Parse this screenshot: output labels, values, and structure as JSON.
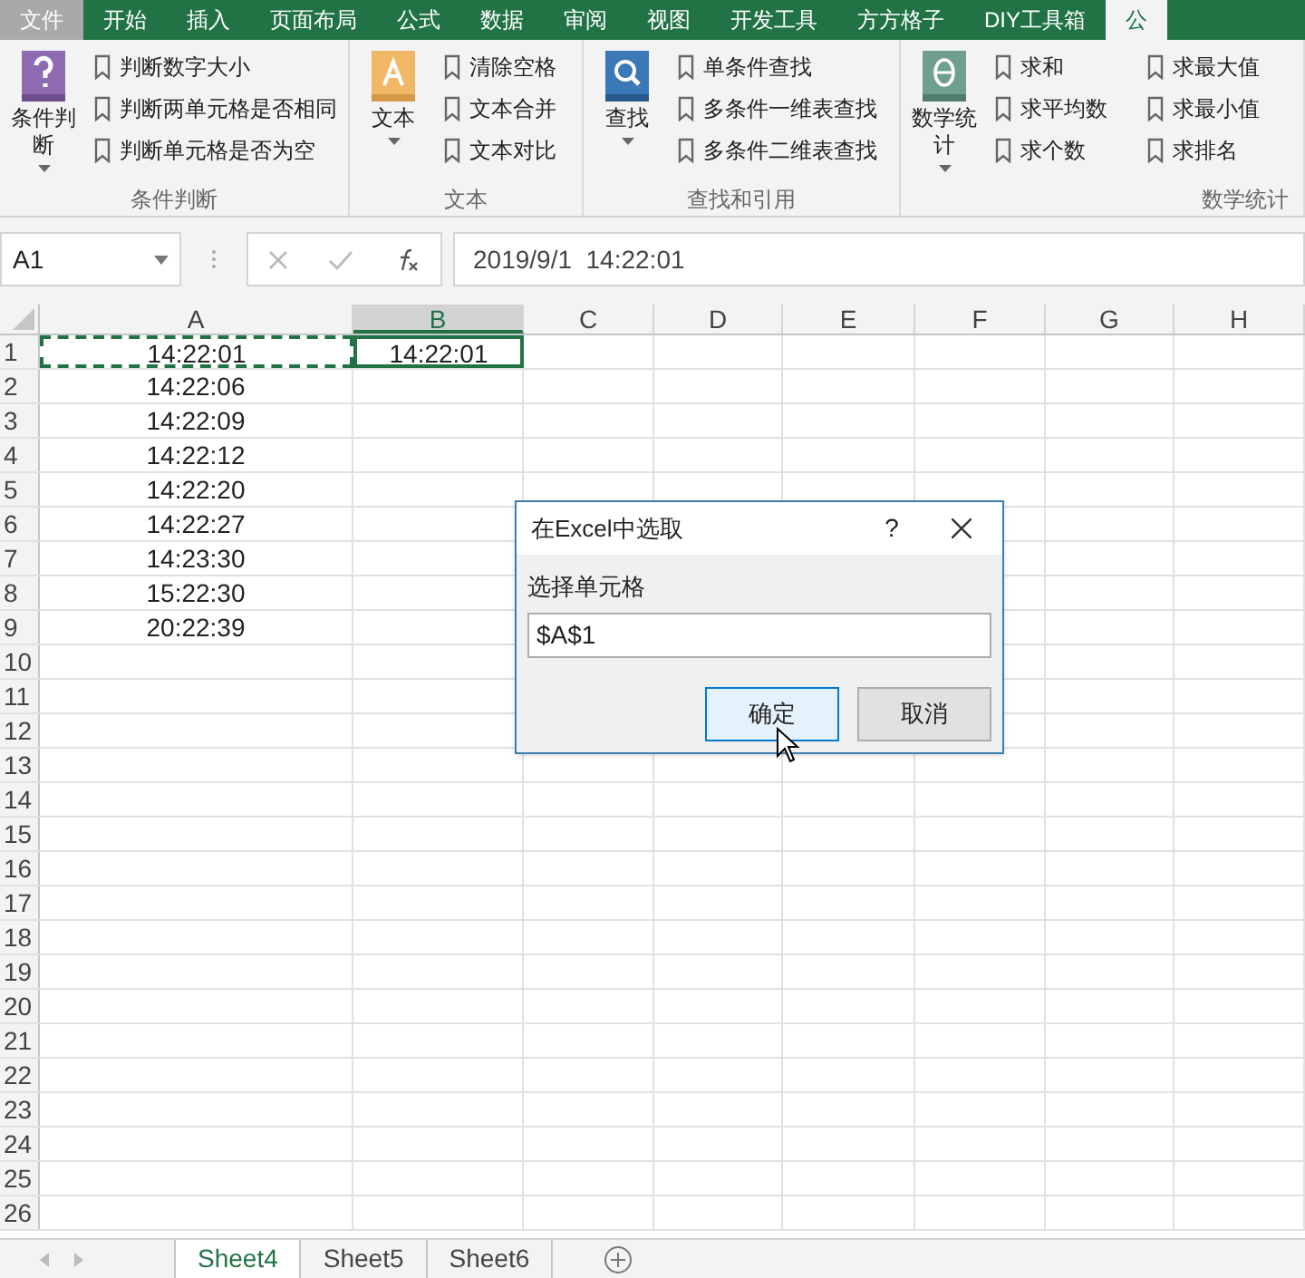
{
  "ribbon_tabs": [
    {
      "label": "文件",
      "kind": "file",
      "selected": false
    },
    {
      "label": "开始",
      "kind": "tab",
      "selected": false
    },
    {
      "label": "插入",
      "kind": "tab",
      "selected": false
    },
    {
      "label": "页面布局",
      "kind": "tab",
      "selected": false
    },
    {
      "label": "公式",
      "kind": "tab",
      "selected": false
    },
    {
      "label": "数据",
      "kind": "tab",
      "selected": false
    },
    {
      "label": "审阅",
      "kind": "tab",
      "selected": false
    },
    {
      "label": "视图",
      "kind": "tab",
      "selected": false
    },
    {
      "label": "开发工具",
      "kind": "tab",
      "selected": false
    },
    {
      "label": "方方格子",
      "kind": "tab",
      "selected": false
    },
    {
      "label": "DIY工具箱",
      "kind": "tab",
      "selected": false
    },
    {
      "label": "公",
      "kind": "tab",
      "selected": true
    }
  ],
  "ribbon_groups": [
    {
      "title": "条件判断",
      "big_button": {
        "label": "条件判断",
        "kind": "question"
      },
      "items": [
        "判断数字大小",
        "判断两单元格是否相同",
        "判断单元格是否为空"
      ]
    },
    {
      "title": "文本",
      "big_button": {
        "label": "文本",
        "kind": "text"
      },
      "items": [
        "清除空格",
        "文本合并",
        "文本对比"
      ]
    },
    {
      "title": "查找和引用",
      "big_button": {
        "label": "查找",
        "kind": "search"
      },
      "items": [
        "单条件查找",
        "多条件一维表查找",
        "多条件二维表查找"
      ]
    },
    {
      "title": "数学统计",
      "big_button": {
        "label": "数学统计",
        "kind": "theta"
      },
      "items": [
        "求和",
        "求平均数",
        "求个数"
      ],
      "items_2": [
        "求最大值",
        "求最小值",
        "求排名"
      ]
    }
  ],
  "formula_bar": {
    "name_box": "A1",
    "formula": "2019/9/1  14:22:01"
  },
  "columns": [
    {
      "label": "A",
      "selected": false
    },
    {
      "label": "B",
      "selected": true
    },
    {
      "label": "C",
      "selected": false
    },
    {
      "label": "D",
      "selected": false
    },
    {
      "label": "E",
      "selected": false
    },
    {
      "label": "F",
      "selected": false
    },
    {
      "label": "G",
      "selected": false
    },
    {
      "label": "H",
      "selected": false
    }
  ],
  "rows": [
    {
      "label": "1",
      "cells": [
        "14:22:01",
        "14:22:01"
      ]
    },
    {
      "label": "2",
      "cells": [
        "14:22:06"
      ]
    },
    {
      "label": "3",
      "cells": [
        "14:22:09"
      ]
    },
    {
      "label": "4",
      "cells": [
        "14:22:12"
      ]
    },
    {
      "label": "5",
      "cells": [
        "14:22:20"
      ]
    },
    {
      "label": "6",
      "cells": [
        "14:22:27"
      ]
    },
    {
      "label": "7",
      "cells": [
        "14:23:30"
      ]
    },
    {
      "label": "8",
      "cells": [
        "15:22:30"
      ]
    },
    {
      "label": "9",
      "cells": [
        "20:22:39"
      ]
    },
    {
      "label": "10",
      "cells": []
    },
    {
      "label": "11",
      "cells": []
    },
    {
      "label": "12",
      "cells": []
    },
    {
      "label": "13",
      "cells": []
    },
    {
      "label": "14",
      "cells": []
    },
    {
      "label": "15",
      "cells": []
    },
    {
      "label": "16",
      "cells": []
    },
    {
      "label": "17",
      "cells": []
    },
    {
      "label": "18",
      "cells": []
    },
    {
      "label": "19",
      "cells": []
    },
    {
      "label": "20",
      "cells": []
    },
    {
      "label": "21",
      "cells": []
    },
    {
      "label": "22",
      "cells": []
    },
    {
      "label": "23",
      "cells": []
    },
    {
      "label": "24",
      "cells": []
    },
    {
      "label": "25",
      "cells": []
    },
    {
      "label": "26",
      "cells": []
    }
  ],
  "sheet_tabs": [
    {
      "label": "Sheet4",
      "selected": true
    },
    {
      "label": "Sheet5",
      "selected": false
    },
    {
      "label": "Sheet6",
      "selected": false
    }
  ],
  "dialog": {
    "title": "在Excel中选取",
    "help": "?",
    "label": "选择单元格",
    "value": "$A$1",
    "buttons": [
      {
        "label": "确定",
        "kind": "primary"
      },
      {
        "label": "取消",
        "kind": "secondary"
      }
    ]
  }
}
